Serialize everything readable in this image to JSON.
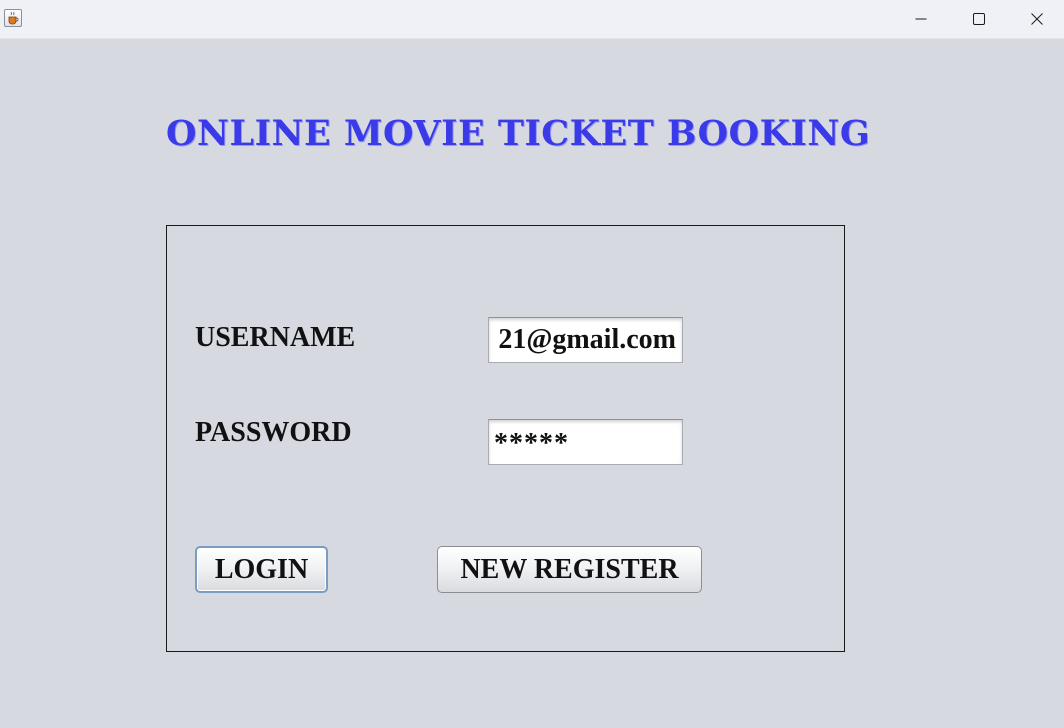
{
  "window": {
    "minimize_symbol": "—",
    "maximize_symbol": "☐",
    "close_symbol": "✕"
  },
  "heading": "ONLINE MOVIE TICKET BOOKING",
  "login_form": {
    "username_label": "USERNAME",
    "username_value": "21@gmail.com",
    "password_label": "PASSWORD",
    "password_value": "*****",
    "login_button": "LOGIN",
    "register_button": "NEW REGISTER"
  },
  "colors": {
    "heading": "#3a3ae8",
    "background": "#d6d9e0",
    "titlebar": "#eff1f6"
  },
  "icons": {
    "app": "java-coffee-icon",
    "minimize": "minimize-icon",
    "maximize": "maximize-icon",
    "close": "close-icon"
  }
}
